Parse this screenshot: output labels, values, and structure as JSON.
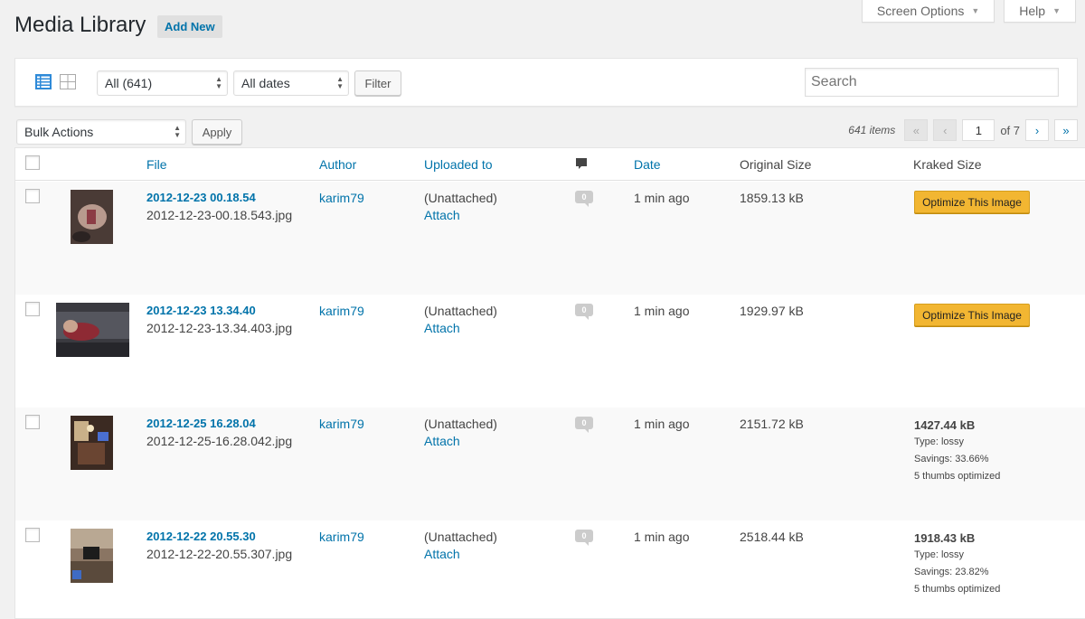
{
  "header": {
    "title": "Media Library",
    "add_new": "Add New",
    "screen_options": "Screen Options",
    "help": "Help"
  },
  "toolbar": {
    "type_filter": "All (641)",
    "date_filter": "All dates",
    "filter_btn": "Filter",
    "search_placeholder": "Search"
  },
  "bulk": {
    "actions": "Bulk Actions",
    "apply": "Apply"
  },
  "pagination": {
    "count": "641 items",
    "first": "«",
    "prev": "‹",
    "current": "1",
    "of": "of 7",
    "next": "›",
    "last": "»"
  },
  "columns": {
    "file": "File",
    "author": "Author",
    "uploaded_to": "Uploaded to",
    "date": "Date",
    "original_size": "Original Size",
    "kraked_size": "Kraked Size"
  },
  "colors": {
    "link": "#0073aa",
    "optimize": "#f2b632"
  },
  "rows": [
    {
      "title": "2012-12-23 00.18.54",
      "filename": "2012-12-23-00.18.543.jpg",
      "author": "karim79",
      "uploaded": "(Unattached)",
      "attach": "Attach",
      "comments": "0",
      "date": "1 min ago",
      "original_size": "1859.13 kB",
      "optimize": "Optimize This Image"
    },
    {
      "title": "2012-12-23 13.34.40",
      "filename": "2012-12-23-13.34.403.jpg",
      "author": "karim79",
      "uploaded": "(Unattached)",
      "attach": "Attach",
      "comments": "0",
      "date": "1 min ago",
      "original_size": "1929.97 kB",
      "optimize": "Optimize This Image"
    },
    {
      "title": "2012-12-25 16.28.04",
      "filename": "2012-12-25-16.28.042.jpg",
      "author": "karim79",
      "uploaded": "(Unattached)",
      "attach": "Attach",
      "comments": "0",
      "date": "1 min ago",
      "original_size": "2151.72 kB",
      "kraked_size": "1427.44 kB",
      "type": "Type: lossy",
      "savings": "Savings: 33.66%",
      "thumbs": "5 thumbs optimized"
    },
    {
      "title": "2012-12-22 20.55.30",
      "filename": "2012-12-22-20.55.307.jpg",
      "author": "karim79",
      "uploaded": "(Unattached)",
      "attach": "Attach",
      "comments": "0",
      "date": "1 min ago",
      "original_size": "2518.44 kB",
      "kraked_size": "1918.43 kB",
      "type": "Type: lossy",
      "savings": "Savings: 23.82%",
      "thumbs": "5 thumbs optimized"
    }
  ]
}
